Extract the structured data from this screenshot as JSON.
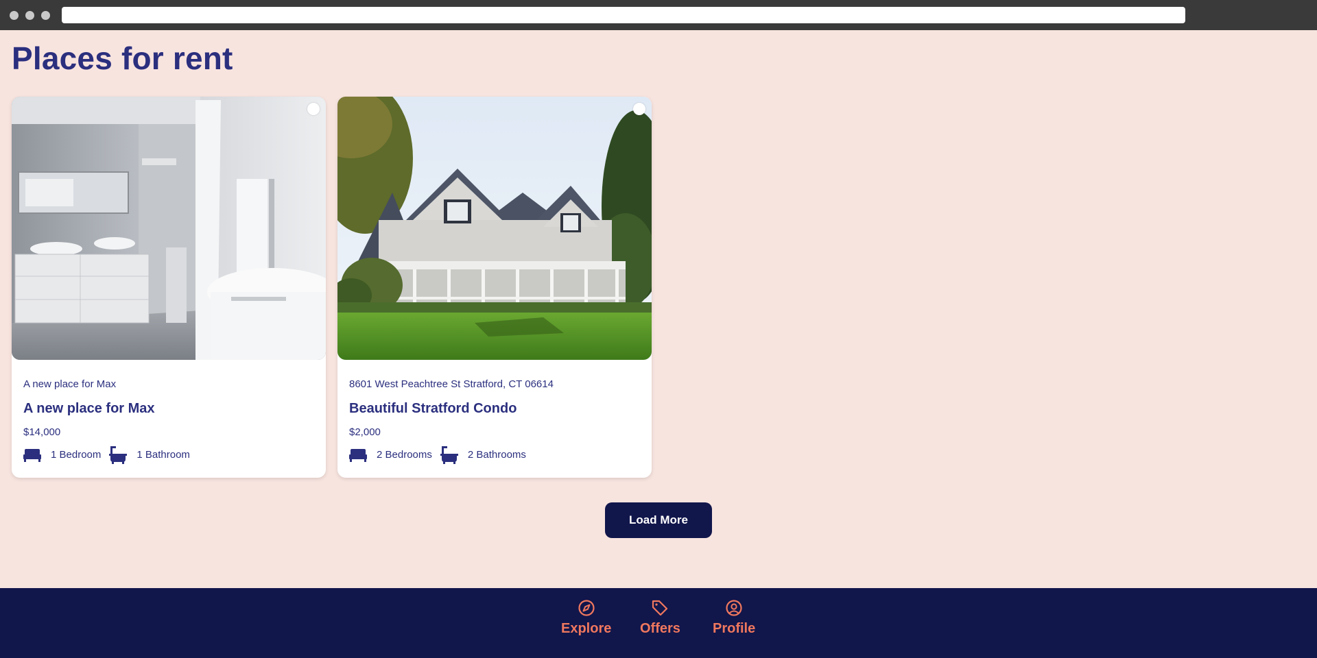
{
  "page": {
    "title": "Places for rent"
  },
  "listings": [
    {
      "address": "A new place for Max",
      "title": "A new place for Max",
      "price": "$14,000",
      "bedrooms": "1 Bedroom",
      "bathrooms": "1 Bathroom",
      "image": "bathroom-interior-photo"
    },
    {
      "address": "8601 West Peachtree St Stratford, CT 06614",
      "title": "Beautiful Stratford Condo",
      "price": "$2,000",
      "bedrooms": "2 Bedrooms",
      "bathrooms": "2 Bathrooms",
      "image": "house-exterior-photo"
    }
  ],
  "actions": {
    "load_more": "Load More"
  },
  "nav": {
    "items": [
      {
        "label": "Explore",
        "icon": "compass-icon"
      },
      {
        "label": "Offers",
        "icon": "tag-icon"
      },
      {
        "label": "Profile",
        "icon": "user-circle-icon"
      }
    ]
  },
  "colors": {
    "background": "#f8e4df",
    "primary": "#2b2f7e",
    "nav_background": "#11164b",
    "nav_accent": "#f0785e"
  }
}
